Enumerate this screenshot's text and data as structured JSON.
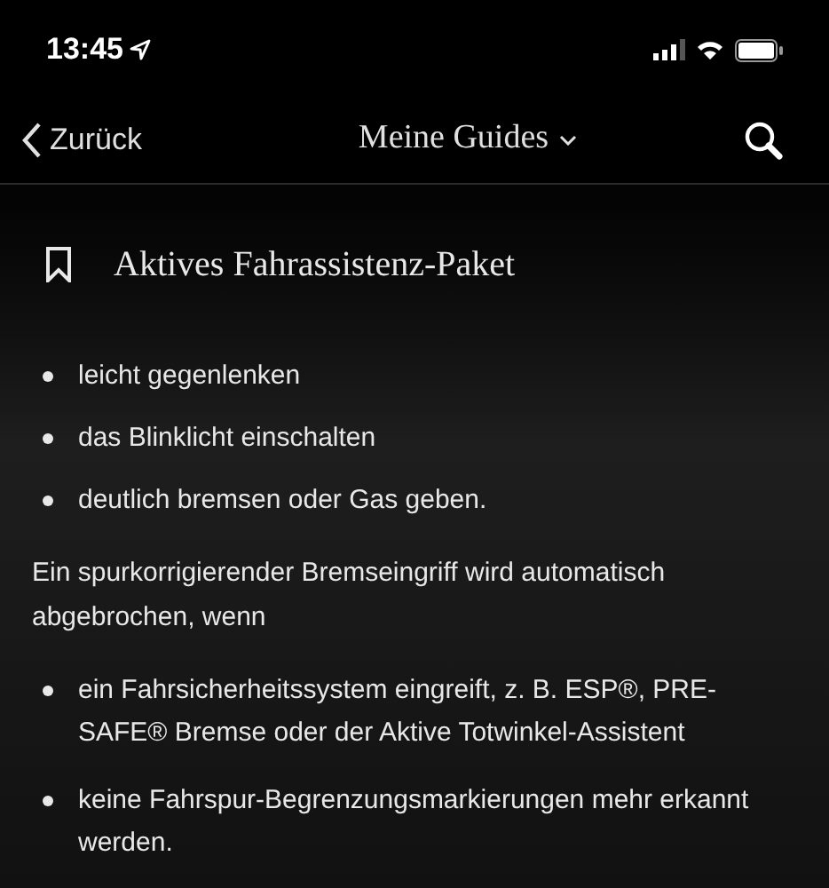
{
  "status_bar": {
    "time": "13:45"
  },
  "nav": {
    "back": "Zurück",
    "title": "Meine Guides"
  },
  "section": {
    "title": "Aktives Fahrassistenz-Paket"
  },
  "list_1": [
    "leicht gegenlenken",
    "das Blinklicht einschalten",
    "deutlich bremsen oder Gas geben."
  ],
  "paragraph": "Ein spurkorrigierender Bremseingriff wird automatisch abgebrochen, wenn",
  "list_2": [
    "ein Fahrsicherheitssystem eingreift, z. B. ESP®, PRE-SAFE® Bremse oder der Aktive Totwinkel-Assistent",
    "keine Fahrspur-Begrenzungsmarkierungen mehr erkannt werden."
  ]
}
